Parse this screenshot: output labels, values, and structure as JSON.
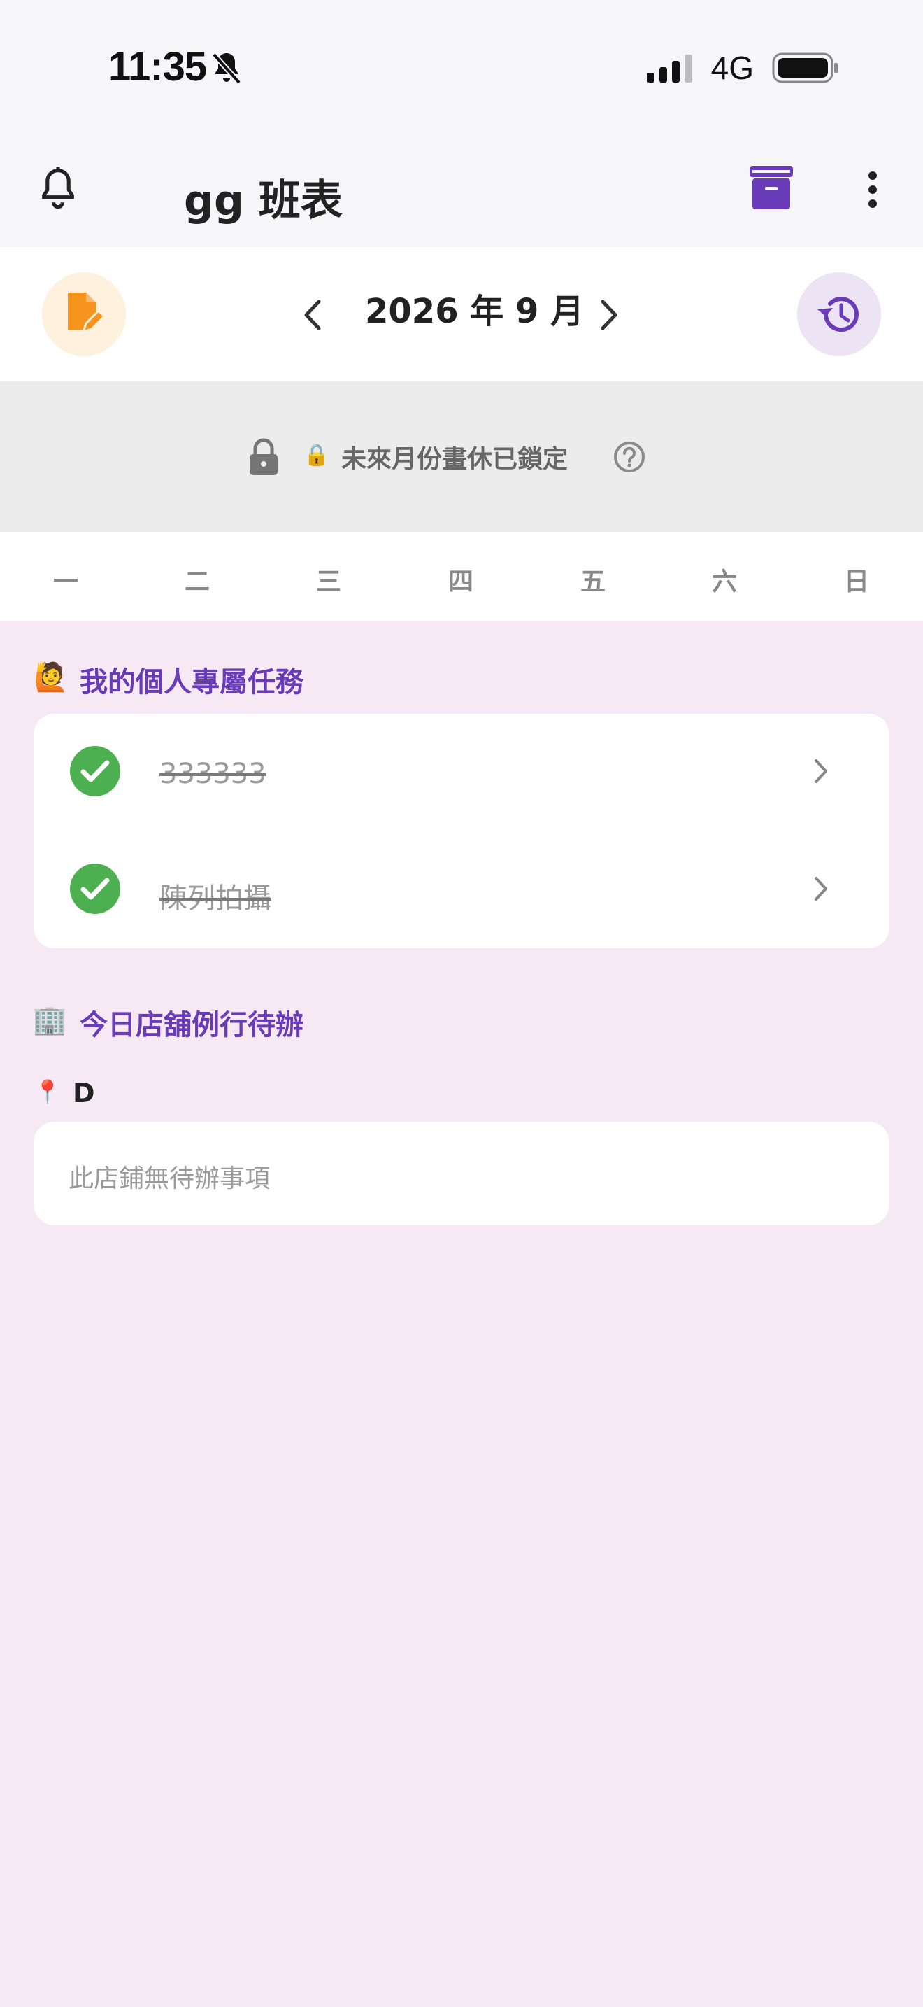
{
  "status_bar": {
    "time": "11:35",
    "network": "4G",
    "silent_icon": "bell-slash-icon"
  },
  "app_bar": {
    "title": "gg 班表",
    "icons": [
      "bell-icon",
      "archive-box-icon",
      "more-vertical-icon"
    ]
  },
  "month_nav": {
    "title": "2026 年 9 月",
    "left_icon": "edit-document-icon",
    "right_icon": "history-icon"
  },
  "lock_banner": {
    "text": "未來月份畫休已鎖定",
    "emoji": "🔒"
  },
  "weekdays": [
    "一",
    "二",
    "三",
    "四",
    "五",
    "六",
    "日"
  ],
  "personal_tasks": {
    "title": "我的個人專屬任務",
    "emoji": "🙋",
    "items": [
      {
        "label": "333333",
        "done": true
      },
      {
        "label": "陳列拍攝",
        "done": true
      }
    ]
  },
  "store_todos": {
    "title": "今日店舖例行待辦",
    "emoji": "🏢",
    "store_emoji": "📍",
    "store_name": "D",
    "empty_text": "此店鋪無待辦事項"
  },
  "colors": {
    "accent": "#6a3bb8",
    "done": "#4caf50",
    "edit": "#f7941d",
    "background": "#f7e9f3"
  }
}
